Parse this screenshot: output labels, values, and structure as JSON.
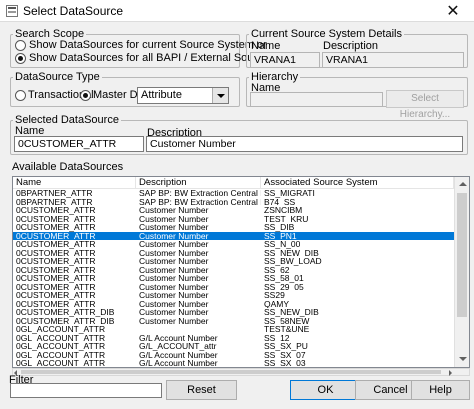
{
  "window": {
    "title": "Select DataSource",
    "close_glyph": "✕"
  },
  "search_scope": {
    "legend": "Search Scope",
    "options": [
      {
        "label": "Show DataSources for current Source System or",
        "selected": false
      },
      {
        "label": "Show DataSources for all BAPI / External Source Systems",
        "selected": true
      }
    ]
  },
  "source_system": {
    "legend": "Current Source System Details",
    "name_label": "Name",
    "description_label": "Description",
    "name_value": "VRANA1",
    "description_value": "VRANA1"
  },
  "datasource_type": {
    "legend": "DataSource Type",
    "transactional_label": "Transactional",
    "transactional_selected": false,
    "master_data_label": "Master Data",
    "master_data_selected": true,
    "master_data_kind": "Attribute"
  },
  "hierarchy": {
    "legend": "Hierarchy",
    "name_label": "Name",
    "name_value": "",
    "select_button": "Select Hierarchy..."
  },
  "selected_datasource": {
    "legend": "Selected DataSource",
    "name_label": "Name",
    "description_label": "Description",
    "name_value": "0CUSTOMER_ATTR",
    "description_value": "Customer Number"
  },
  "available": {
    "label": "Available DataSources",
    "columns": [
      "Name",
      "Description",
      "Associated Source System"
    ],
    "selected_index": 5,
    "rows": [
      [
        "0BPARTNER_ATTR",
        "SAP BP: BW Extraction Central Data",
        "SS_MIGRATI"
      ],
      [
        "0BPARTNER_ATTR",
        "SAP BP: BW Extraction Central Data",
        "B74_SS"
      ],
      [
        "0CUSTOMER_ATTR",
        "Customer Number",
        "ZSNCIBM"
      ],
      [
        "0CUSTOMER_ATTR",
        "Customer Number",
        "TEST_KRU"
      ],
      [
        "0CUSTOMER_ATTR",
        "Customer Number",
        "SS_DIB"
      ],
      [
        "0CUSTOMER_ATTR",
        "Customer Number",
        "SS_PN1"
      ],
      [
        "0CUSTOMER_ATTR",
        "Customer Number",
        "SS_N_00"
      ],
      [
        "0CUSTOMER_ATTR",
        "Customer Number",
        "SS_NEW_DIB"
      ],
      [
        "0CUSTOMER_ATTR",
        "Customer Number",
        "SS_BW_LOAD"
      ],
      [
        "0CUSTOMER_ATTR",
        "Customer Number",
        "SS_62"
      ],
      [
        "0CUSTOMER_ATTR",
        "Customer Number",
        "SS_58_01"
      ],
      [
        "0CUSTOMER_ATTR",
        "Customer Number",
        "SS_29_05"
      ],
      [
        "0CUSTOMER_ATTR",
        "Customer Number",
        "SS29"
      ],
      [
        "0CUSTOMER_ATTR",
        "Customer Number",
        "QAMY"
      ],
      [
        "0CUSTOMER_ATTR_DIB",
        "Customer Number",
        "SS_NEW_DIB"
      ],
      [
        "0CUSTOMER_ATTR_DIB",
        "Customer Number",
        "SS_58NEW"
      ],
      [
        "0GL_ACCOUNT_ATTR",
        "",
        "TEST&UNE"
      ],
      [
        "0GL_ACCOUNT_ATTR",
        "G/L Account Number",
        "SS_12"
      ],
      [
        "0GL_ACCOUNT_ATTR",
        "G/L_ACCOUNT_attr",
        "SS_SX_PU"
      ],
      [
        "0GL_ACCOUNT_ATTR",
        "G/L Account Number",
        "SS_SX_07"
      ],
      [
        "0GL_ACCOUNT_ATTR",
        "G/L Account Number",
        "SS_SX_03"
      ]
    ]
  },
  "filter": {
    "label": "Filter",
    "value": ""
  },
  "buttons": {
    "reset": "Reset",
    "ok": "OK",
    "cancel": "Cancel",
    "help": "Help"
  }
}
